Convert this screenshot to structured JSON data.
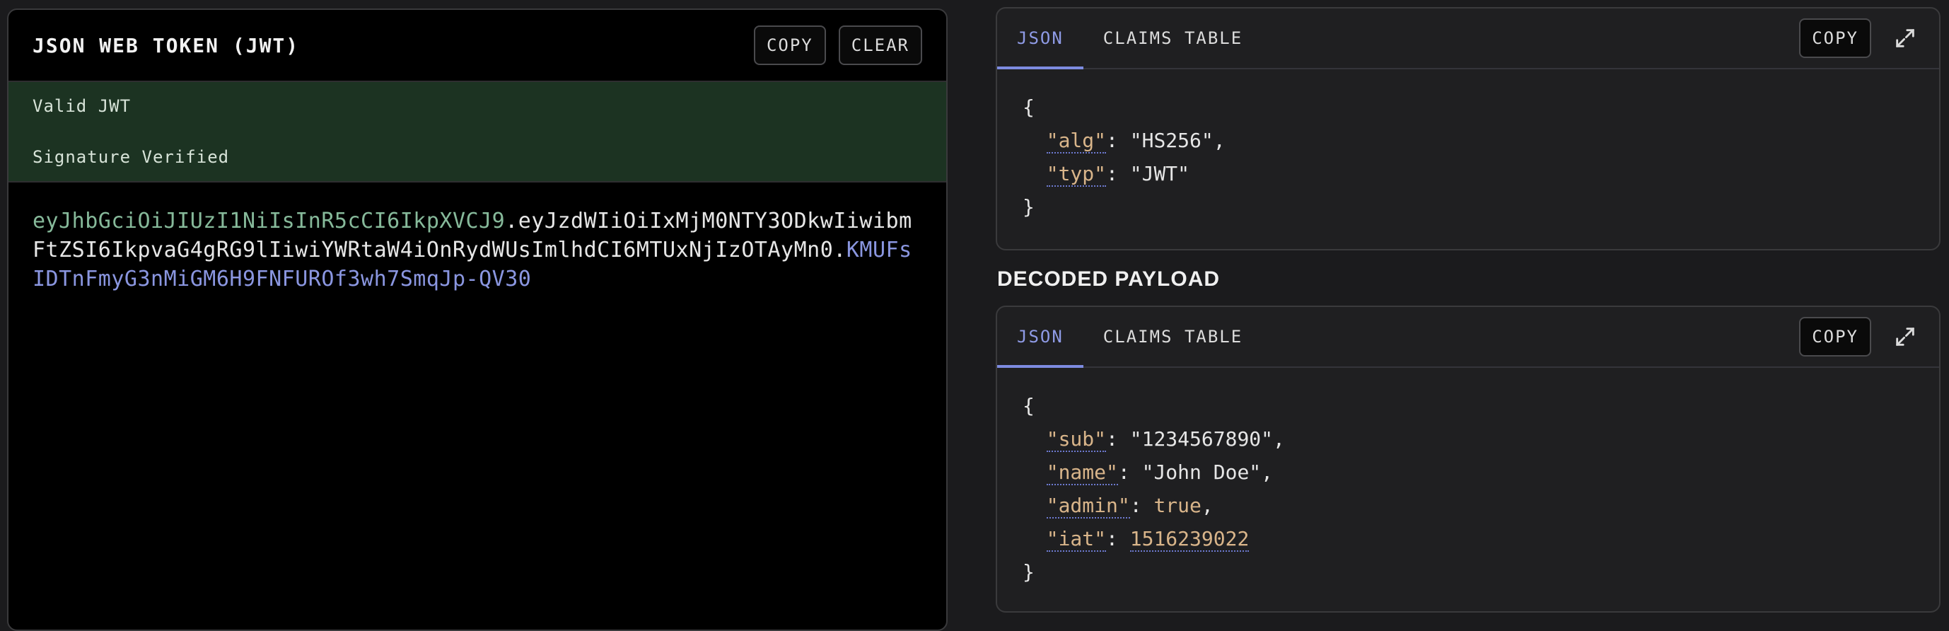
{
  "encoded": {
    "title": "JSON WEB TOKEN (JWT)",
    "copy_label": "COPY",
    "clear_label": "CLEAR",
    "status_valid": "Valid JWT",
    "status_signature": "Signature Verified",
    "token_header": "eyJhbGciOiJIUzI1NiIsInR5cCI6IkpXVCJ9",
    "token_payload": "eyJzdWIiOiIxMjM0NTY3ODkwIiwibmFtZSI6IkpvaG4gRG9lIiwiYWRtaW4iOnRydWUsImlhdCI6MTUxNjIzOTAyMn0",
    "token_signature": "KMUFsIDTnFmyG3nMiGM6H9FNFUROf3wh7SmqJp-QV30",
    "dot": "."
  },
  "header_card": {
    "tab_json": "JSON",
    "tab_claims": "CLAIMS TABLE",
    "copy_label": "COPY",
    "brace_open": "{",
    "brace_close": "}",
    "fields": [
      {
        "key": "\"alg\"",
        "value": "\"HS256\","
      },
      {
        "key": "\"typ\"",
        "value": "\"JWT\""
      }
    ]
  },
  "payload_section": {
    "label": "DECODED PAYLOAD"
  },
  "payload_card": {
    "tab_json": "JSON",
    "tab_claims": "CLAIMS TABLE",
    "copy_label": "COPY",
    "brace_open": "{",
    "brace_close": "}",
    "fields": [
      {
        "key": "\"sub\"",
        "value": "\"1234567890\","
      },
      {
        "key": "\"name\"",
        "value": "\"John Doe\","
      },
      {
        "key": "\"admin\"",
        "value": "true"
      },
      {
        "key": "\"iat\"",
        "value": "1516239022"
      }
    ],
    "admin_comma": ","
  },
  "icons": {
    "expand": "expand-icon"
  },
  "colors": {
    "accent": "#7d8be0",
    "token_header": "#86b99a",
    "token_signature": "#8a96e0",
    "status_bg": "#1c3322",
    "key_color": "#d9b58a"
  }
}
